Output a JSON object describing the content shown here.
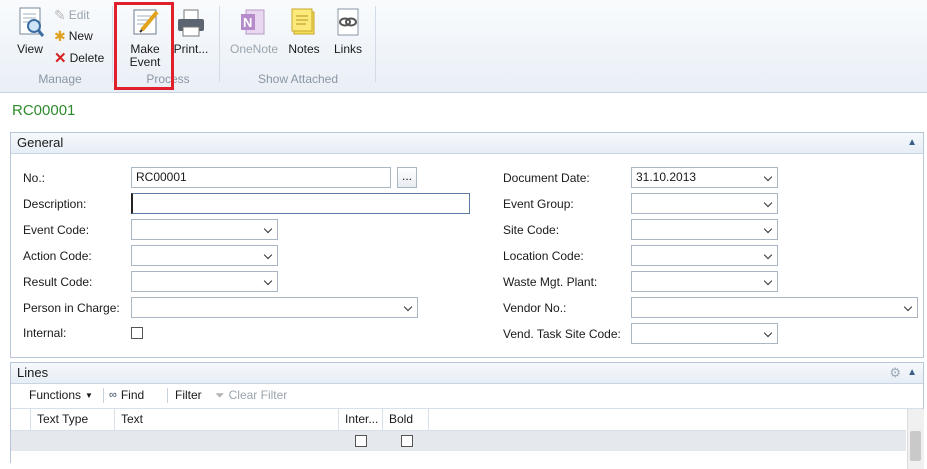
{
  "ribbon": {
    "view": "View",
    "edit": "Edit",
    "new": "New",
    "delete": "Delete",
    "make_event": "Make Event",
    "print": "Print...",
    "onenote": "OneNote",
    "notes": "Notes",
    "links": "Links",
    "groups": {
      "manage": "Manage",
      "process": "Process",
      "show_attached": "Show Attached"
    }
  },
  "record_title": "RC00001",
  "general": {
    "header": "General",
    "fields": {
      "no": {
        "label": "No.:",
        "value": "RC00001"
      },
      "description": {
        "label": "Description:",
        "value": ""
      },
      "event_code": {
        "label": "Event Code:",
        "value": ""
      },
      "action_code": {
        "label": "Action Code:",
        "value": ""
      },
      "result_code": {
        "label": "Result Code:",
        "value": ""
      },
      "person_in_charge": {
        "label": "Person in Charge:",
        "value": ""
      },
      "internal": {
        "label": "Internal:",
        "checked": false
      },
      "document_date": {
        "label": "Document Date:",
        "value": "31.10.2013"
      },
      "event_group": {
        "label": "Event Group:",
        "value": ""
      },
      "site_code": {
        "label": "Site Code:",
        "value": ""
      },
      "location_code": {
        "label": "Location Code:",
        "value": ""
      },
      "waste_mgt_plant": {
        "label": "Waste Mgt. Plant:",
        "value": ""
      },
      "vendor_no": {
        "label": "Vendor No.:",
        "value": ""
      },
      "vend_task_site_code": {
        "label": "Vend. Task Site Code:",
        "value": ""
      }
    },
    "assist_button": "..."
  },
  "lines": {
    "header": "Lines",
    "toolbar": {
      "functions": "Functions",
      "find": "Find",
      "filter": "Filter",
      "clear_filter": "Clear Filter"
    },
    "columns": [
      "Text Type",
      "Text",
      "Inter...",
      "Bold"
    ]
  },
  "colors": {
    "title_green": "#2e8b2e",
    "highlight_red": "#e0202a"
  }
}
